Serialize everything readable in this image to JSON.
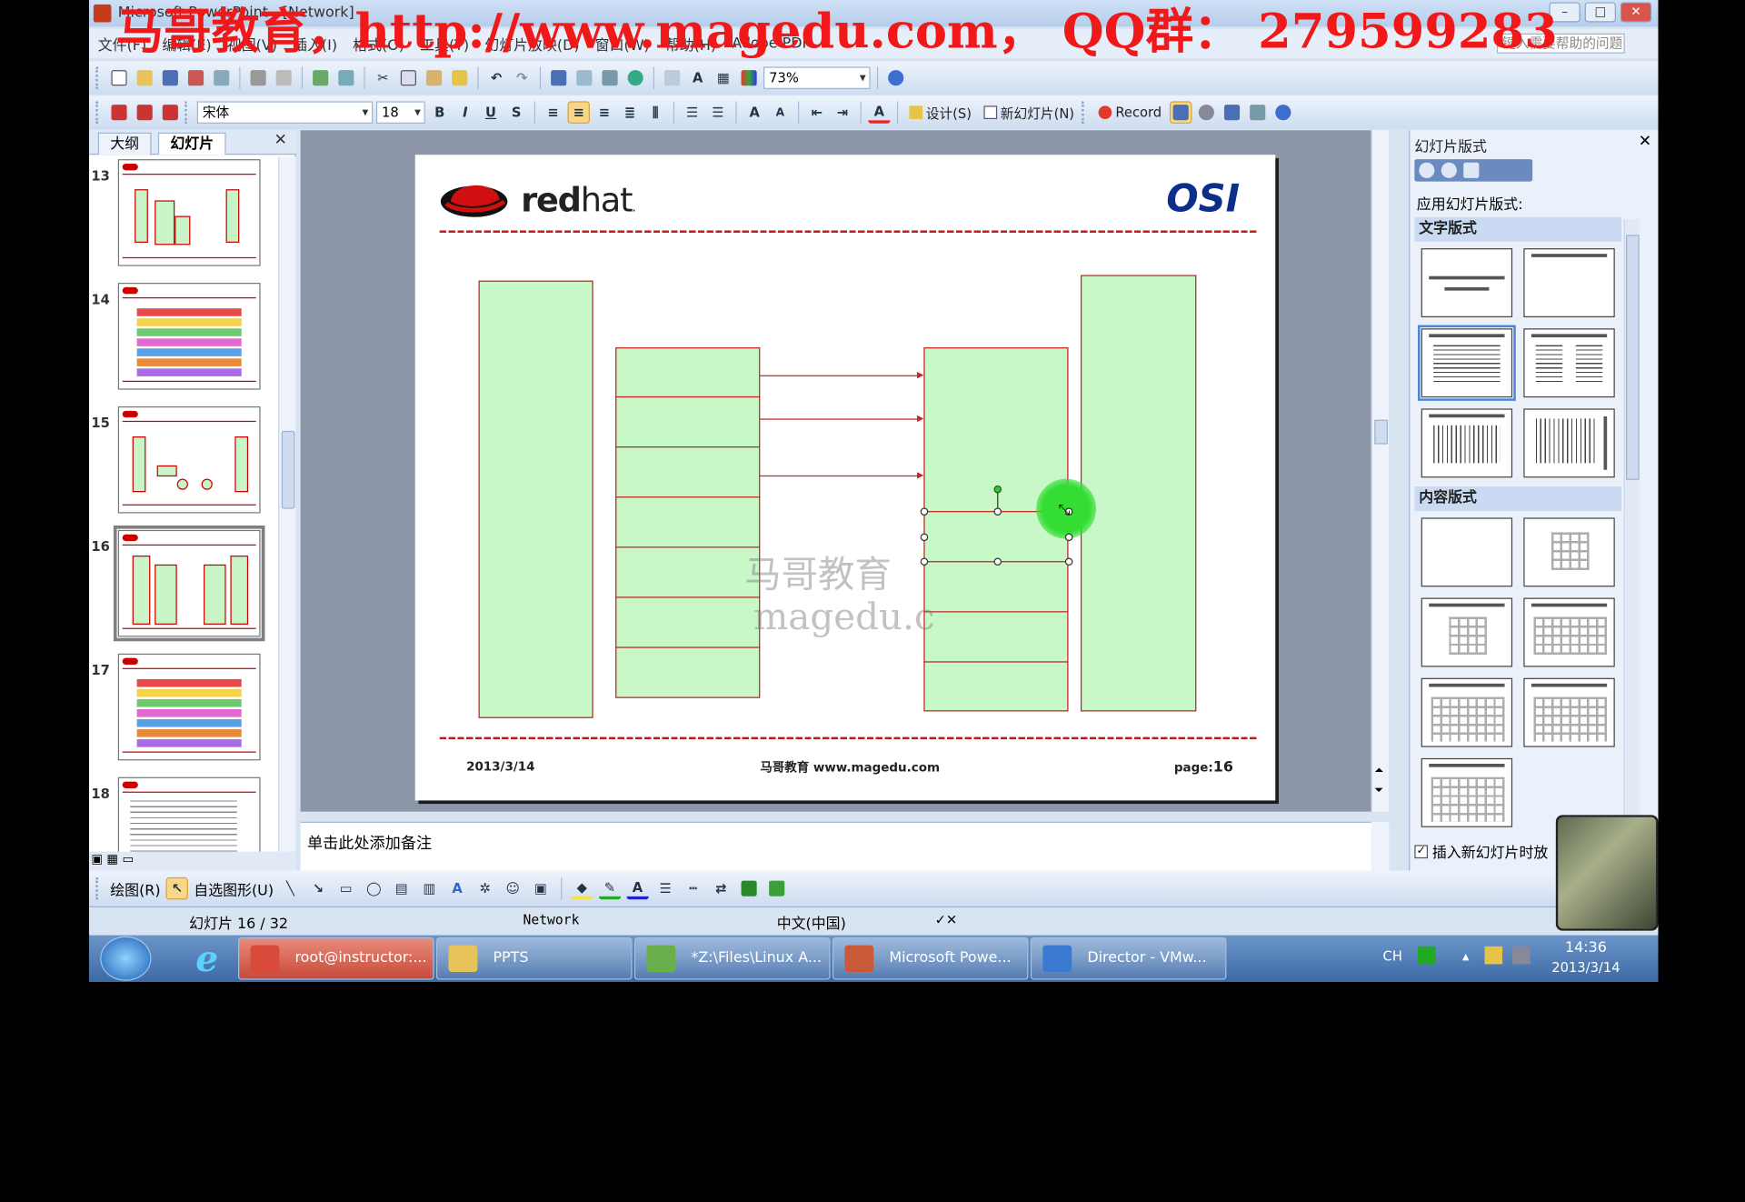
{
  "window": {
    "title": "Microsoft PowerPoint - [Network]"
  },
  "watermark": "马哥教育，http://www.magedu.com， QQ群： 279599283",
  "menu": [
    "文件(F)",
    "编辑(E)",
    "视图(V)",
    "插入(I)",
    "格式(O)",
    "工具(T)",
    "幻灯片放映(D)",
    "窗口(W)",
    "帮助(H)",
    "Adobe PDF"
  ],
  "menu_help_placeholder": "键入需要帮助的问题",
  "toolbar1": {
    "zoom": "73%"
  },
  "toolbar2": {
    "font": "宋体",
    "size": "18",
    "bold": "B",
    "italic": "I",
    "underline": "U",
    "shadow": "S",
    "design": "设计(S)",
    "new_slide": "新幻灯片(N)",
    "record": "Record"
  },
  "left_pane": {
    "tabs": [
      "大纲",
      "幻灯片"
    ],
    "thumbs": [
      {
        "num": "13",
        "kind": "diagram-a"
      },
      {
        "num": "14",
        "kind": "table"
      },
      {
        "num": "15",
        "kind": "diagram-b"
      },
      {
        "num": "16",
        "kind": "diagram-c",
        "selected": true
      },
      {
        "num": "17",
        "kind": "table"
      },
      {
        "num": "18",
        "kind": "text"
      }
    ]
  },
  "slide": {
    "logo": "redhat",
    "title": "OSI",
    "watermark_cn": "马哥教育",
    "watermark_url": "magedu.c",
    "footer_date": "2013/3/14",
    "footer_center": "马哥教育 www.magedu.com",
    "footer_page_label": "page:",
    "footer_page_num": "16"
  },
  "notes_placeholder": "单击此处添加备注",
  "task_pane": {
    "title": "幻灯片版式",
    "apply_label": "应用幻灯片版式:",
    "section_text": "文字版式",
    "section_content": "内容版式",
    "insert_check": "插入新幻灯片时放"
  },
  "drawbar": {
    "draw": "绘图(R)",
    "autoshape": "自选图形(U)"
  },
  "status": {
    "slide": "幻灯片 16 / 32",
    "template": "Network",
    "lang": "中文(中国)"
  },
  "taskbar": {
    "tasks": [
      "root@instructor:...",
      "PPTS",
      "*Z:\\Files\\Linux A...",
      "Microsoft Powe...",
      "Director - VMw..."
    ],
    "time": "14:36",
    "date": "2013/3/14",
    "lang": "CH"
  },
  "colors": {
    "slide_box": "#c8f7c8",
    "slide_line": "#c02020",
    "osi_blue": "#0d2e8a",
    "watermark_red": "#f01818"
  }
}
